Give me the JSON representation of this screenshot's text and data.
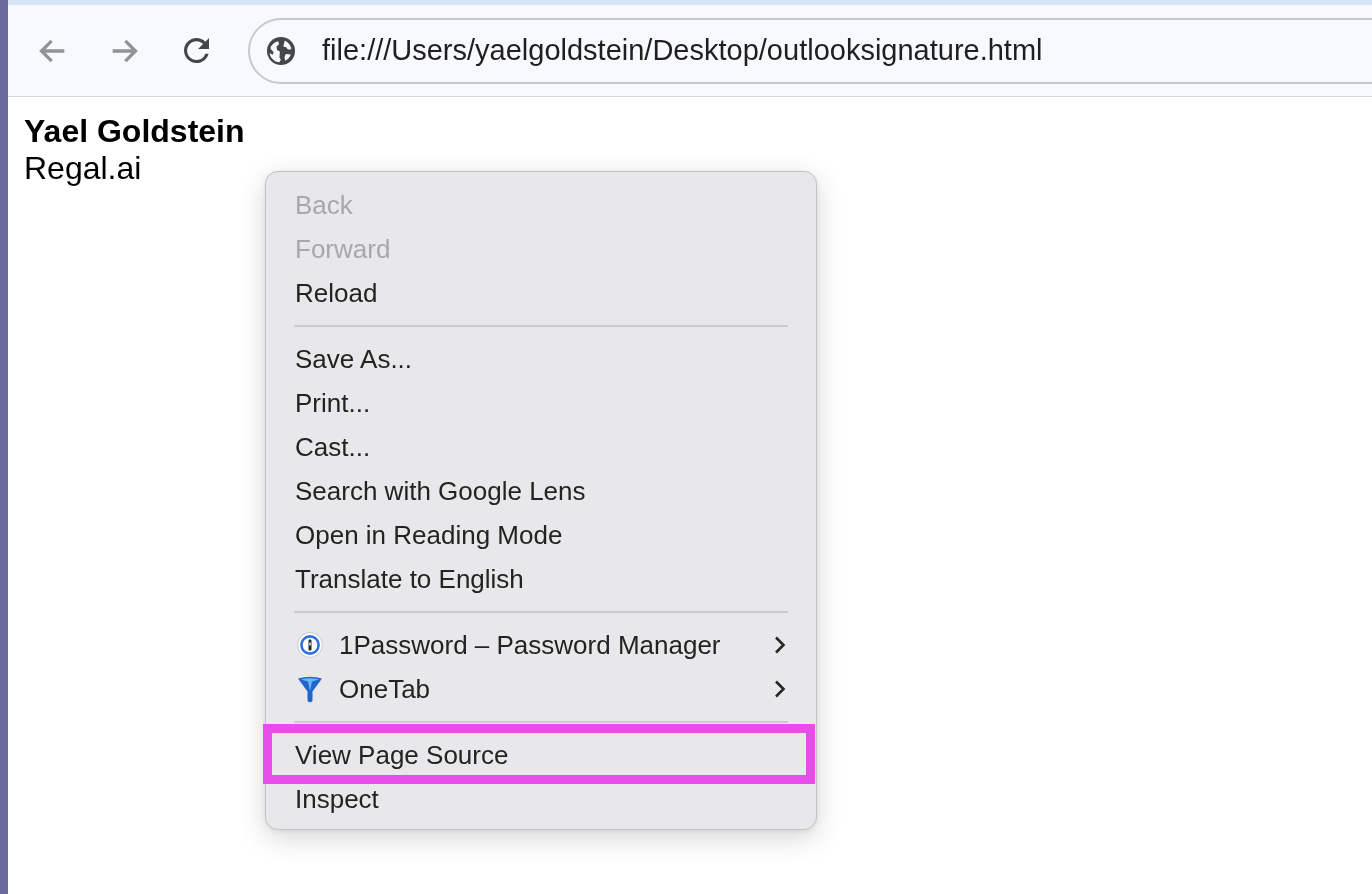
{
  "browser": {
    "nav_buttons": [
      {
        "kind": "back",
        "disabled": true
      },
      {
        "kind": "forward",
        "disabled": true
      },
      {
        "kind": "reload",
        "disabled": false
      }
    ],
    "address_bar": {
      "url": "file:///Users/yaelgoldstein/Desktop/outlooksignature.html"
    }
  },
  "page": {
    "name": "Yael Goldstein",
    "company": "Regal.ai"
  },
  "context_menu": {
    "groups": [
      {
        "items": [
          {
            "label": "Back",
            "kind": "plain",
            "disabled": true,
            "submenu": false,
            "highlighted": false
          },
          {
            "label": "Forward",
            "kind": "plain",
            "disabled": true,
            "submenu": false,
            "highlighted": false
          },
          {
            "label": "Reload",
            "kind": "plain",
            "disabled": false,
            "submenu": false,
            "highlighted": false
          }
        ]
      },
      {
        "items": [
          {
            "label": "Save As...",
            "kind": "plain",
            "disabled": false,
            "submenu": false,
            "highlighted": false
          },
          {
            "label": "Print...",
            "kind": "plain",
            "disabled": false,
            "submenu": false,
            "highlighted": false
          },
          {
            "label": "Cast...",
            "kind": "plain",
            "disabled": false,
            "submenu": false,
            "highlighted": false
          },
          {
            "label": "Search with Google Lens",
            "kind": "plain",
            "disabled": false,
            "submenu": false,
            "highlighted": false
          },
          {
            "label": "Open in Reading Mode",
            "kind": "plain",
            "disabled": false,
            "submenu": false,
            "highlighted": false
          },
          {
            "label": "Translate to English",
            "kind": "plain",
            "disabled": false,
            "submenu": false,
            "highlighted": false
          }
        ]
      },
      {
        "items": [
          {
            "label": "1Password – Password Manager",
            "kind": "extension",
            "disabled": false,
            "submenu": true,
            "highlighted": false
          },
          {
            "label": "OneTab",
            "kind": "extension",
            "disabled": false,
            "submenu": true,
            "highlighted": false
          }
        ]
      },
      {
        "items": [
          {
            "label": "View Page Source",
            "kind": "plain",
            "disabled": false,
            "submenu": false,
            "highlighted": true
          },
          {
            "label": "Inspect",
            "kind": "plain",
            "disabled": false,
            "submenu": false,
            "highlighted": false
          }
        ]
      }
    ]
  }
}
